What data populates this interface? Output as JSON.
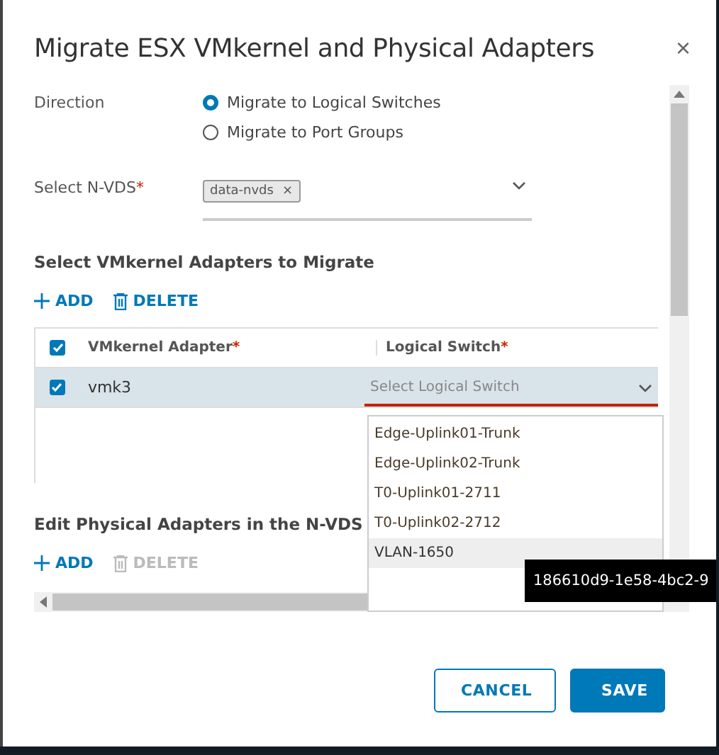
{
  "dialog": {
    "title": "Migrate ESX VMkernel and Physical Adapters",
    "close": "×"
  },
  "direction": {
    "label": "Direction",
    "options": [
      {
        "label": "Migrate to Logical Switches",
        "selected": true
      },
      {
        "label": "Migrate to Port Groups",
        "selected": false
      }
    ]
  },
  "nvds": {
    "label": "Select N-VDS",
    "required": "*",
    "chips": [
      {
        "label": "data-nvds",
        "remove": "×"
      }
    ]
  },
  "vmkernel_section": {
    "title": "Select VMkernel Adapters to Migrate",
    "actions": [
      {
        "kind": "add",
        "label": "ADD",
        "disabled": false
      },
      {
        "kind": "delete",
        "label": "DELETE",
        "disabled": false
      }
    ]
  },
  "table": {
    "header_checked": true,
    "columns": [
      {
        "label": "VMkernel Adapter",
        "required": "*"
      },
      {
        "label": "Logical Switch",
        "required": "*"
      }
    ],
    "rows": [
      {
        "checked": true,
        "selected": true,
        "adapter": "vmk3",
        "switch_placeholder": "Select Logical Switch"
      }
    ]
  },
  "dropdown": {
    "options": [
      {
        "label": "Edge-Uplink01-Trunk",
        "highlighted": false
      },
      {
        "label": "Edge-Uplink02-Trunk",
        "highlighted": false
      },
      {
        "label": "T0-Uplink01-2711",
        "highlighted": false
      },
      {
        "label": "T0-Uplink02-2712",
        "highlighted": false
      },
      {
        "label": "VLAN-1650",
        "highlighted": true
      }
    ]
  },
  "tooltip": "186610d9-1e58-4bc2-9",
  "physical_section": {
    "title": "Edit Physical Adapters in the N-VDS",
    "actions": [
      {
        "kind": "add",
        "label": "ADD",
        "disabled": false
      },
      {
        "kind": "delete",
        "label": "DELETE",
        "disabled": true
      }
    ]
  },
  "buttons": [
    {
      "label": "CANCEL",
      "kind": "outline"
    },
    {
      "label": "SAVE",
      "kind": "primary"
    }
  ]
}
